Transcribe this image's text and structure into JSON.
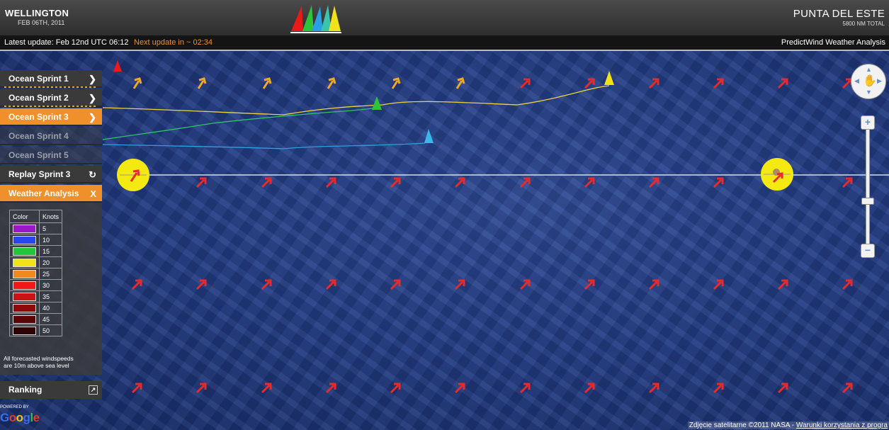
{
  "header": {
    "start_city": "WELLINGTON",
    "start_date": "FEB 06TH, 2011",
    "end_city": "PUNTA DEL ESTE",
    "total_distance": "5800 NM TOTAL"
  },
  "infobar": {
    "latest_update": "Latest update: Feb 12nd UTC 06:12",
    "next_update": "Next update in ~ 02:34",
    "provider": "PredictWind Weather Analysis"
  },
  "sidebar": {
    "items": [
      {
        "label": "Ocean Sprint 1",
        "icon": "chevron-right-icon",
        "state": "normal"
      },
      {
        "label": "Ocean Sprint 2",
        "icon": "chevron-right-icon",
        "state": "normal"
      },
      {
        "label": "Ocean Sprint 3",
        "icon": "chevron-right-icon",
        "state": "active"
      },
      {
        "label": "Ocean Sprint 4",
        "icon": "chevron-right-icon",
        "state": "disabled"
      },
      {
        "label": "Ocean Sprint 5",
        "icon": "chevron-right-icon",
        "state": "disabled"
      },
      {
        "label": "Replay Sprint 3",
        "icon": "refresh-icon",
        "state": "normal"
      },
      {
        "label": "Weather Analysis",
        "icon": "close-icon",
        "close_symbol": "X",
        "state": "active"
      }
    ],
    "ranking": "Ranking"
  },
  "legend": {
    "col_color": "Color",
    "col_knots": "Knots",
    "rows": [
      {
        "color": "#9b18c8",
        "knots": "5"
      },
      {
        "color": "#2a44f0",
        "knots": "10"
      },
      {
        "color": "#22c63a",
        "knots": "15"
      },
      {
        "color": "#f2e21a",
        "knots": "20"
      },
      {
        "color": "#f08a1c",
        "knots": "25"
      },
      {
        "color": "#f21818",
        "knots": "30"
      },
      {
        "color": "#c81414",
        "knots": "35"
      },
      {
        "color": "#8e0a0a",
        "knots": "40"
      },
      {
        "color": "#5a0606",
        "knots": "45"
      },
      {
        "color": "#2e0404",
        "knots": "50"
      }
    ],
    "note_line1": "All forecasted windspeeds",
    "note_line2": "are 10m above sea level"
  },
  "footer": {
    "powered_by": "POWERED BY",
    "google": "Google",
    "copyright": "Zdjęcie satelitarne ©2011 NASA - ",
    "terms_link": "Warunki korzystania z progra"
  },
  "map": {
    "zoom_in": "+",
    "zoom_out": "−",
    "boat_colors": [
      "#e81a1a",
      "#2ec43a",
      "#3ab8e8",
      "#f2e21a"
    ],
    "track_colors": [
      "#f2d23a",
      "#2ec46a",
      "#2ea0e0"
    ]
  }
}
